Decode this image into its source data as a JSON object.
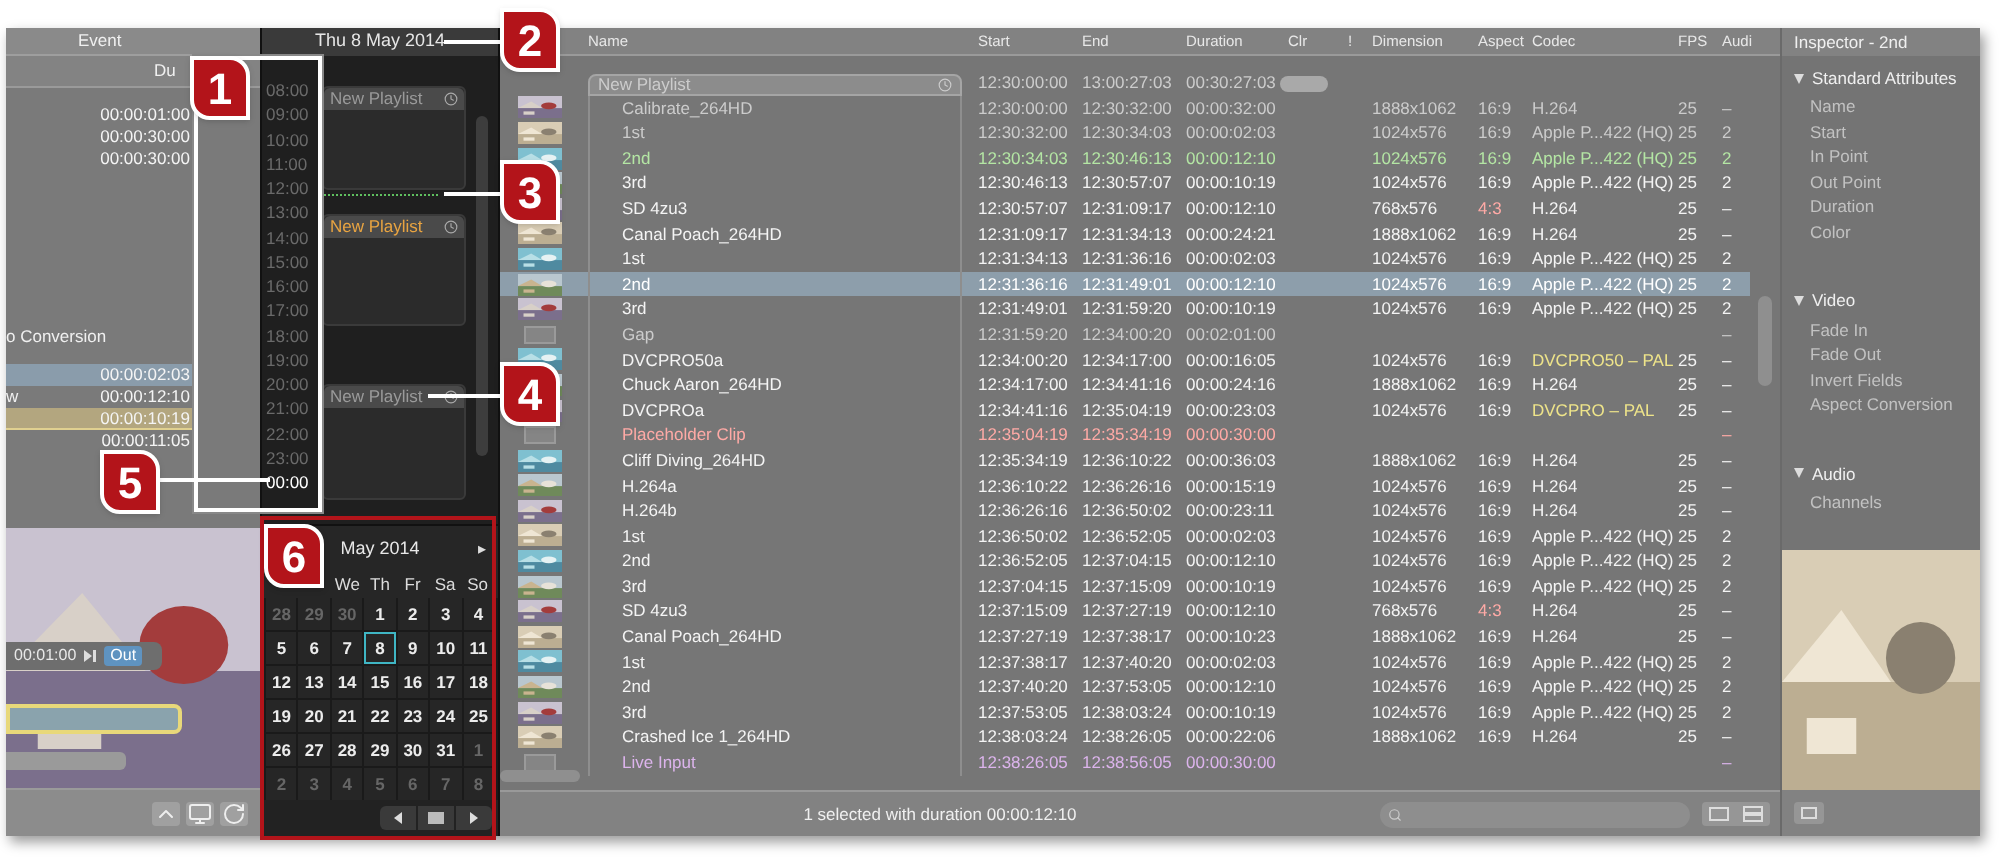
{
  "browser": {
    "header": "Event",
    "subheader": "Du",
    "rows": [
      {
        "duration": "00:00:01:00",
        "selected": false,
        "highlighted": false
      },
      {
        "duration": "00:00:30:00",
        "selected": false,
        "highlighted": false
      },
      {
        "duration": "00:00:30:00",
        "selected": false,
        "highlighted": false
      },
      {
        "label": "o Conversion",
        "selected": false,
        "highlighted": false
      },
      {
        "duration": "00:00:02:03",
        "selected": true,
        "highlighted": false
      },
      {
        "label": "w",
        "duration": "00:00:12:10",
        "selected": false,
        "highlighted": false
      },
      {
        "duration": "00:00:10:19",
        "selected": false,
        "highlighted": true
      },
      {
        "duration": "00:00:11:05",
        "selected": false,
        "highlighted": false
      }
    ],
    "viewer": {
      "timecode": "00:01:00",
      "out_button": "Out"
    }
  },
  "schedule": {
    "date": "Thu 8 May 2014",
    "hours": [
      {
        "label": "08:00",
        "selected": false
      },
      {
        "label": "09:00",
        "selected": false
      },
      {
        "label": "10:00",
        "selected": false
      },
      {
        "label": "11:00",
        "selected": false
      },
      {
        "label": "12:00",
        "selected": false
      },
      {
        "label": "13:00",
        "selected": false
      },
      {
        "label": "14:00",
        "selected": false
      },
      {
        "label": "15:00",
        "selected": false
      },
      {
        "label": "16:00",
        "selected": false
      },
      {
        "label": "17:00",
        "selected": false
      },
      {
        "label": "18:00",
        "selected": false
      },
      {
        "label": "19:00",
        "selected": false
      },
      {
        "label": "20:00",
        "selected": false
      },
      {
        "label": "21:00",
        "selected": false
      },
      {
        "label": "22:00",
        "selected": false
      },
      {
        "label": "23:00",
        "selected": false
      },
      {
        "label": "00:00",
        "selected": true
      }
    ],
    "playlists": [
      {
        "title": "New Playlist",
        "selected": false
      },
      {
        "title": "New Playlist",
        "selected": true
      },
      {
        "title": "New Playlist",
        "selected": false
      }
    ]
  },
  "calendar": {
    "month": "May 2014",
    "next": "▸",
    "weekdays": [
      "We",
      "Th",
      "Fr",
      "Sa",
      "So"
    ],
    "days": [
      {
        "label": "28",
        "other": true,
        "selected": false
      },
      {
        "label": "29",
        "other": true,
        "selected": false
      },
      {
        "label": "30",
        "other": true,
        "selected": false
      },
      {
        "label": "1",
        "other": false,
        "selected": false
      },
      {
        "label": "2",
        "other": false,
        "selected": false
      },
      {
        "label": "3",
        "other": false,
        "selected": false
      },
      {
        "label": "4",
        "other": false,
        "selected": false
      },
      {
        "label": "5",
        "other": false,
        "selected": false
      },
      {
        "label": "6",
        "other": false,
        "selected": false
      },
      {
        "label": "7",
        "other": false,
        "selected": false
      },
      {
        "label": "8",
        "other": false,
        "selected": true
      },
      {
        "label": "9",
        "other": false,
        "selected": false
      },
      {
        "label": "10",
        "other": false,
        "selected": false
      },
      {
        "label": "11",
        "other": false,
        "selected": false
      },
      {
        "label": "12",
        "other": false,
        "selected": false
      },
      {
        "label": "13",
        "other": false,
        "selected": false
      },
      {
        "label": "14",
        "other": false,
        "selected": false
      },
      {
        "label": "15",
        "other": false,
        "selected": false
      },
      {
        "label": "16",
        "other": false,
        "selected": false
      },
      {
        "label": "17",
        "other": false,
        "selected": false
      },
      {
        "label": "18",
        "other": false,
        "selected": false
      },
      {
        "label": "19",
        "other": false,
        "selected": false
      },
      {
        "label": "20",
        "other": false,
        "selected": false
      },
      {
        "label": "21",
        "other": false,
        "selected": false
      },
      {
        "label": "22",
        "other": false,
        "selected": false
      },
      {
        "label": "23",
        "other": false,
        "selected": false
      },
      {
        "label": "24",
        "other": false,
        "selected": false
      },
      {
        "label": "25",
        "other": false,
        "selected": false
      },
      {
        "label": "26",
        "other": false,
        "selected": false
      },
      {
        "label": "27",
        "other": false,
        "selected": false
      },
      {
        "label": "28",
        "other": false,
        "selected": false
      },
      {
        "label": "29",
        "other": false,
        "selected": false
      },
      {
        "label": "30",
        "other": false,
        "selected": false
      },
      {
        "label": "31",
        "other": false,
        "selected": false
      },
      {
        "label": "1",
        "other": true,
        "selected": false
      },
      {
        "label": "2",
        "other": true,
        "selected": false
      },
      {
        "label": "3",
        "other": true,
        "selected": false
      },
      {
        "label": "4",
        "other": true,
        "selected": false
      },
      {
        "label": "5",
        "other": true,
        "selected": false
      },
      {
        "label": "6",
        "other": true,
        "selected": false
      },
      {
        "label": "7",
        "other": true,
        "selected": false
      },
      {
        "label": "8",
        "other": true,
        "selected": false
      }
    ]
  },
  "table": {
    "columns": [
      "Name",
      "Start",
      "End",
      "Duration",
      "Clr",
      "!",
      "Dimension",
      "Aspect",
      "Codec",
      "FPS",
      "Audi"
    ],
    "rows": [
      {
        "kind": "group",
        "color": "#cccccc",
        "selected": false,
        "name": "New Playlist",
        "start": "12:30:00:00",
        "end": "13:00:27:03",
        "duration": "00:30:27:03"
      },
      {
        "kind": "clip",
        "color": "#cccccc",
        "selected": false,
        "name": "Calibrate_264HD",
        "start": "12:30:00:00",
        "end": "12:30:32:00",
        "duration": "00:00:32:00",
        "dimension": "1888x1062",
        "aspect": "16:9",
        "codec": "H.264",
        "fps": "25",
        "audio": "–",
        "aspect_mismatch": false,
        "codec_flag": false
      },
      {
        "kind": "clip",
        "color": "#cccccc",
        "selected": false,
        "name": "1st",
        "start": "12:30:32:00",
        "end": "12:30:34:03",
        "duration": "00:00:02:03",
        "dimension": "1024x576",
        "aspect": "16:9",
        "codec": "Apple P...422 (HQ)",
        "fps": "25",
        "audio": "2",
        "aspect_mismatch": false,
        "codec_flag": false
      },
      {
        "kind": "clip",
        "color": "#b4e6a4",
        "selected": false,
        "name": "2nd",
        "start": "12:30:34:03",
        "end": "12:30:46:13",
        "duration": "00:00:12:10",
        "dimension": "1024x576",
        "aspect": "16:9",
        "codec": "Apple P...422 (HQ)",
        "fps": "25",
        "audio": "2",
        "aspect_mismatch": false,
        "codec_flag": false
      },
      {
        "kind": "clip",
        "color": "#f4f4f4",
        "selected": false,
        "name": "3rd",
        "start": "12:30:46:13",
        "end": "12:30:57:07",
        "duration": "00:00:10:19",
        "dimension": "1024x576",
        "aspect": "16:9",
        "codec": "Apple P...422 (HQ)",
        "fps": "25",
        "audio": "2",
        "aspect_mismatch": false,
        "codec_flag": false
      },
      {
        "kind": "clip",
        "color": "#f4f4f4",
        "selected": false,
        "name": "SD 4zu3",
        "start": "12:30:57:07",
        "end": "12:31:09:17",
        "duration": "00:00:12:10",
        "dimension": "768x576",
        "aspect": "4:3",
        "codec": "H.264",
        "fps": "25",
        "audio": "–",
        "aspect_mismatch": true,
        "codec_flag": false
      },
      {
        "kind": "clip",
        "color": "#f4f4f4",
        "selected": false,
        "name": "Canal Poach_264HD",
        "start": "12:31:09:17",
        "end": "12:31:34:13",
        "duration": "00:00:24:21",
        "dimension": "1888x1062",
        "aspect": "16:9",
        "codec": "H.264",
        "fps": "25",
        "audio": "–",
        "aspect_mismatch": false,
        "codec_flag": false
      },
      {
        "kind": "clip",
        "color": "#f4f4f4",
        "selected": false,
        "name": "1st",
        "start": "12:31:34:13",
        "end": "12:31:36:16",
        "duration": "00:00:02:03",
        "dimension": "1024x576",
        "aspect": "16:9",
        "codec": "Apple P...422 (HQ)",
        "fps": "25",
        "audio": "2",
        "aspect_mismatch": false,
        "codec_flag": false
      },
      {
        "kind": "clip",
        "selected": true,
        "name": "2nd",
        "start": "12:31:36:16",
        "end": "12:31:49:01",
        "duration": "00:00:12:10",
        "dimension": "1024x576",
        "aspect": "16:9",
        "codec": "Apple P...422 (HQ)",
        "fps": "25",
        "audio": "2",
        "aspect_mismatch": false,
        "codec_flag": false
      },
      {
        "kind": "clip",
        "color": "#f4f4f4",
        "selected": false,
        "name": "3rd",
        "start": "12:31:49:01",
        "end": "12:31:59:20",
        "duration": "00:00:10:19",
        "dimension": "1024x576",
        "aspect": "16:9",
        "codec": "Apple P...422 (HQ)",
        "fps": "25",
        "audio": "2",
        "aspect_mismatch": false,
        "codec_flag": false
      },
      {
        "kind": "gap",
        "color": "#cccccc",
        "selected": false,
        "name": "Gap",
        "start": "12:31:59:20",
        "end": "12:34:00:20",
        "duration": "00:02:01:00",
        "audio": "–"
      },
      {
        "kind": "clip",
        "color": "#f4f4f4",
        "selected": false,
        "name": "DVCPRO50a",
        "start": "12:34:00:20",
        "end": "12:34:17:00",
        "duration": "00:00:16:05",
        "dimension": "1024x576",
        "aspect": "16:9",
        "codec": "DVCPRO50 – PAL",
        "fps": "25",
        "audio": "–",
        "aspect_mismatch": false,
        "codec_flag": true
      },
      {
        "kind": "clip",
        "color": "#f4f4f4",
        "selected": false,
        "name": "Chuck Aaron_264HD",
        "start": "12:34:17:00",
        "end": "12:34:41:16",
        "duration": "00:00:24:16",
        "dimension": "1888x1062",
        "aspect": "16:9",
        "codec": "H.264",
        "fps": "25",
        "audio": "–",
        "aspect_mismatch": false,
        "codec_flag": false
      },
      {
        "kind": "clip",
        "color": "#f4f4f4",
        "selected": false,
        "name": "DVCPROa",
        "start": "12:34:41:16",
        "end": "12:35:04:19",
        "duration": "00:00:23:03",
        "dimension": "1024x576",
        "aspect": "16:9",
        "codec": "DVCPRO – PAL",
        "fps": "25",
        "audio": "–",
        "aspect_mismatch": false,
        "codec_flag": true
      },
      {
        "kind": "placeholder",
        "color": "#ffaaa6",
        "selected": false,
        "name": "Placeholder Clip",
        "start": "12:35:04:19",
        "end": "12:35:34:19",
        "duration": "00:00:30:00",
        "audio": "–"
      },
      {
        "kind": "clip",
        "color": "#f4f4f4",
        "selected": false,
        "name": "Cliff Diving_264HD",
        "start": "12:35:34:19",
        "end": "12:36:10:22",
        "duration": "00:00:36:03",
        "dimension": "1888x1062",
        "aspect": "16:9",
        "codec": "H.264",
        "fps": "25",
        "audio": "–",
        "aspect_mismatch": false,
        "codec_flag": false
      },
      {
        "kind": "clip",
        "color": "#f4f4f4",
        "selected": false,
        "name": "H.264a",
        "start": "12:36:10:22",
        "end": "12:36:26:16",
        "duration": "00:00:15:19",
        "dimension": "1024x576",
        "aspect": "16:9",
        "codec": "H.264",
        "fps": "25",
        "audio": "–",
        "aspect_mismatch": false,
        "codec_flag": false
      },
      {
        "kind": "clip",
        "color": "#f4f4f4",
        "selected": false,
        "name": "H.264b",
        "start": "12:36:26:16",
        "end": "12:36:50:02",
        "duration": "00:00:23:11",
        "dimension": "1024x576",
        "aspect": "16:9",
        "codec": "H.264",
        "fps": "25",
        "audio": "–",
        "aspect_mismatch": false,
        "codec_flag": false
      },
      {
        "kind": "clip",
        "color": "#f4f4f4",
        "selected": false,
        "name": "1st",
        "start": "12:36:50:02",
        "end": "12:36:52:05",
        "duration": "00:00:02:03",
        "dimension": "1024x576",
        "aspect": "16:9",
        "codec": "Apple P...422 (HQ)",
        "fps": "25",
        "audio": "2",
        "aspect_mismatch": false,
        "codec_flag": false
      },
      {
        "kind": "clip",
        "color": "#f4f4f4",
        "selected": false,
        "name": "2nd",
        "start": "12:36:52:05",
        "end": "12:37:04:15",
        "duration": "00:00:12:10",
        "dimension": "1024x576",
        "aspect": "16:9",
        "codec": "Apple P...422 (HQ)",
        "fps": "25",
        "audio": "2",
        "aspect_mismatch": false,
        "codec_flag": false
      },
      {
        "kind": "clip",
        "color": "#f4f4f4",
        "selected": false,
        "name": "3rd",
        "start": "12:37:04:15",
        "end": "12:37:15:09",
        "duration": "00:00:10:19",
        "dimension": "1024x576",
        "aspect": "16:9",
        "codec": "Apple P...422 (HQ)",
        "fps": "25",
        "audio": "2",
        "aspect_mismatch": false,
        "codec_flag": false
      },
      {
        "kind": "clip",
        "color": "#f4f4f4",
        "selected": false,
        "name": "SD 4zu3",
        "start": "12:37:15:09",
        "end": "12:37:27:19",
        "duration": "00:00:12:10",
        "dimension": "768x576",
        "aspect": "4:3",
        "codec": "H.264",
        "fps": "25",
        "audio": "–",
        "aspect_mismatch": true,
        "codec_flag": false
      },
      {
        "kind": "clip",
        "color": "#f4f4f4",
        "selected": false,
        "name": "Canal Poach_264HD",
        "start": "12:37:27:19",
        "end": "12:37:38:17",
        "duration": "00:00:10:23",
        "dimension": "1888x1062",
        "aspect": "16:9",
        "codec": "H.264",
        "fps": "25",
        "audio": "–",
        "aspect_mismatch": false,
        "codec_flag": false
      },
      {
        "kind": "clip",
        "color": "#f4f4f4",
        "selected": false,
        "name": "1st",
        "start": "12:37:38:17",
        "end": "12:37:40:20",
        "duration": "00:00:02:03",
        "dimension": "1024x576",
        "aspect": "16:9",
        "codec": "Apple P...422 (HQ)",
        "fps": "25",
        "audio": "2",
        "aspect_mismatch": false,
        "codec_flag": false
      },
      {
        "kind": "clip",
        "color": "#f4f4f4",
        "selected": false,
        "name": "2nd",
        "start": "12:37:40:20",
        "end": "12:37:53:05",
        "duration": "00:00:12:10",
        "dimension": "1024x576",
        "aspect": "16:9",
        "codec": "Apple P...422 (HQ)",
        "fps": "25",
        "audio": "2",
        "aspect_mismatch": false,
        "codec_flag": false
      },
      {
        "kind": "clip",
        "color": "#f4f4f4",
        "selected": false,
        "name": "3rd",
        "start": "12:37:53:05",
        "end": "12:38:03:24",
        "duration": "00:00:10:19",
        "dimension": "1024x576",
        "aspect": "16:9",
        "codec": "Apple P...422 (HQ)",
        "fps": "25",
        "audio": "2",
        "aspect_mismatch": false,
        "codec_flag": false
      },
      {
        "kind": "clip",
        "color": "#f4f4f4",
        "selected": false,
        "name": "Crashed Ice 1_264HD",
        "start": "12:38:03:24",
        "end": "12:38:26:05",
        "duration": "00:00:22:06",
        "dimension": "1888x1062",
        "aspect": "16:9",
        "codec": "H.264",
        "fps": "25",
        "audio": "–",
        "aspect_mismatch": false,
        "codec_flag": false
      },
      {
        "kind": "live",
        "color": "#dcb4ec",
        "selected": false,
        "name": "Live Input",
        "start": "12:38:26:05",
        "end": "12:38:56:05",
        "duration": "00:00:30:00",
        "audio": "–"
      }
    ]
  },
  "status_bar": {
    "text": "1 selected with duration 00:00:12:10"
  },
  "inspector": {
    "title": "Inspector - 2nd",
    "sections": [
      {
        "title": "Standard Attributes",
        "expanded": true,
        "items": [
          "Name",
          "Start",
          "In Point",
          "Out Point",
          "Duration",
          "Color"
        ]
      },
      {
        "title": "Video",
        "expanded": true,
        "items": [
          "Fade In",
          "Fade Out",
          "Invert Fields",
          "Aspect Conversion"
        ]
      },
      {
        "title": "Audio",
        "expanded": true,
        "items": [
          "Channels"
        ]
      }
    ]
  },
  "callouts": [
    {
      "label": "1"
    },
    {
      "label": "2"
    },
    {
      "label": "3"
    },
    {
      "label": "4"
    },
    {
      "label": "5"
    },
    {
      "label": "6"
    }
  ]
}
